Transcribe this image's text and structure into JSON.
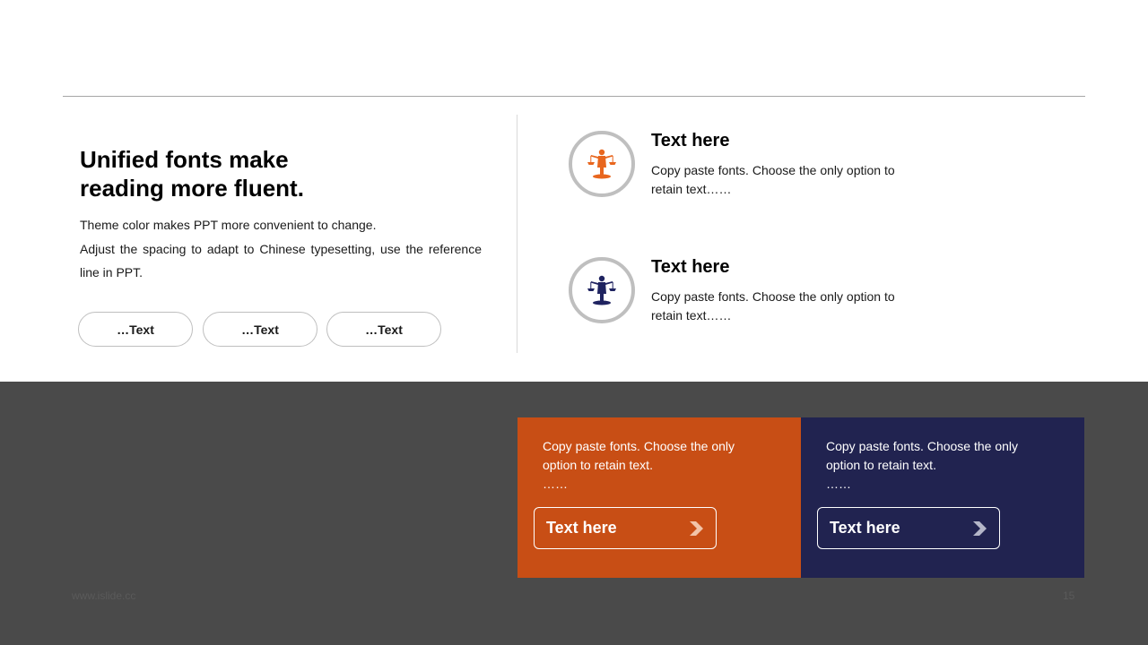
{
  "left": {
    "headline_line1": "Unified fonts make",
    "headline_line2": "reading more fluent.",
    "body_line1": "Theme color makes PPT more convenient  to change.",
    "body_line2": "Adjust the spacing to adapt to Chinese typesetting, use the reference",
    "body_line3": "line  in  PPT.",
    "pills": [
      "…Text",
      "…Text",
      "…Text"
    ]
  },
  "features": [
    {
      "icon": "justice-figure-icon",
      "icon_color": "#e8661e",
      "title": "Text here",
      "desc_line1": "Copy paste fonts. Choose the only option to",
      "desc_line2": "retain text……"
    },
    {
      "icon": "justice-figure-icon",
      "icon_color": "#1f2360",
      "title": "Text here",
      "desc_line1": "Copy paste fonts. Choose the only option to",
      "desc_line2": "retain text……"
    }
  ],
  "cards": [
    {
      "color": "#c84e15",
      "text_line1": "Copy paste fonts. Choose the only",
      "text_line2": "option to retain text.",
      "ellipsis": "……",
      "button_label": "Text here",
      "chevron": "chevron-right-icon"
    },
    {
      "color": "#212350",
      "text_line1": "Copy paste fonts. Choose the only",
      "text_line2": "option to retain text.",
      "ellipsis": "……",
      "button_label": "Text here",
      "chevron": "chevron-right-icon"
    }
  ],
  "footer": {
    "site": "www.islide.cc",
    "page_number": "15"
  }
}
